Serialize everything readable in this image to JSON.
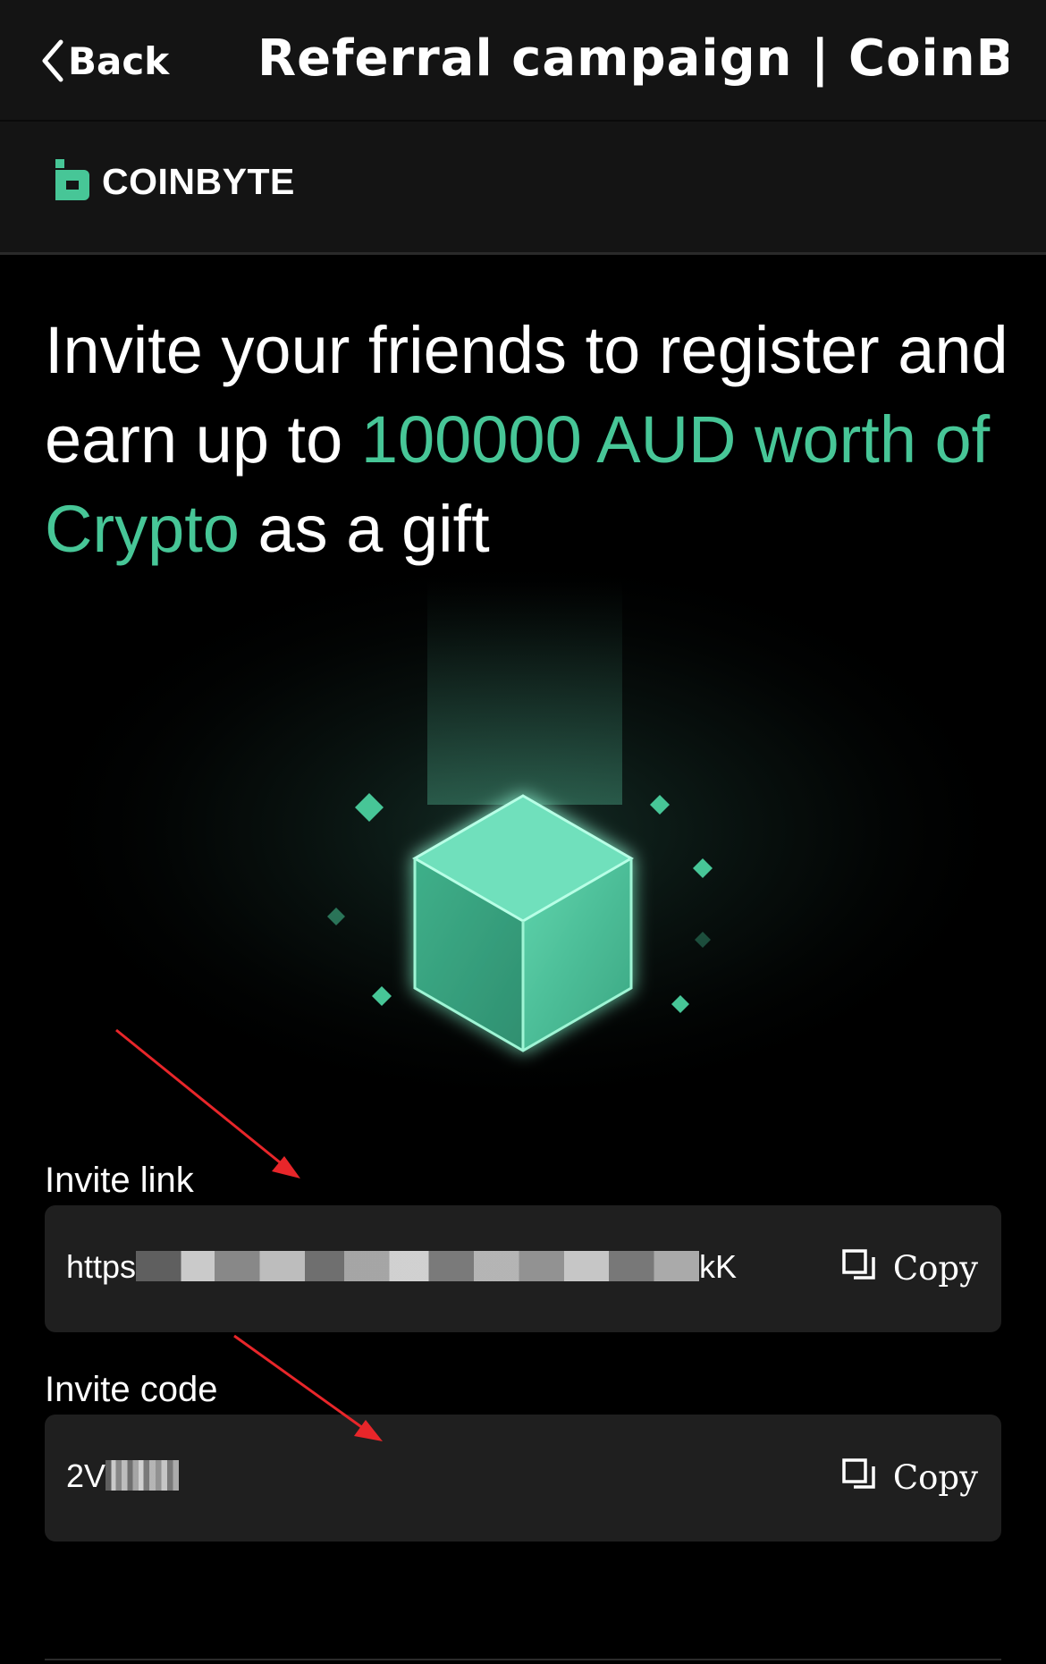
{
  "nav": {
    "back_label": "Back",
    "title": "Referral campaign | CoinBy..."
  },
  "brand": {
    "name": "COINBYTE",
    "accent_color": "#47c697"
  },
  "headline": {
    "part1": "Invite your friends to register and earn up to ",
    "highlight": "100000 AUD worth of Crypto",
    "part2": " as a gift"
  },
  "invite_link": {
    "label": "Invite link",
    "value_prefix": "https",
    "value_suffix": "kK",
    "copy_label": "Copy"
  },
  "invite_code": {
    "label": "Invite code",
    "value_prefix": "2V",
    "copy_label": "Copy"
  }
}
